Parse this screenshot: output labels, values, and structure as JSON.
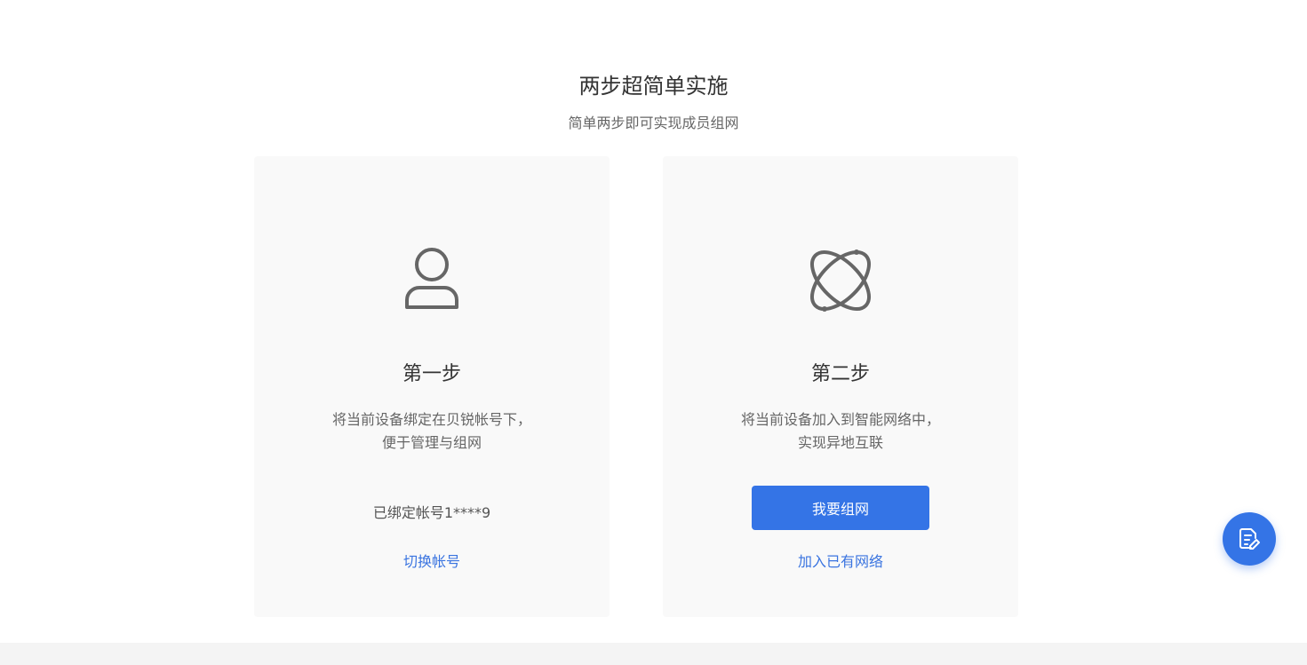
{
  "header": {
    "title": "两步超简单实施",
    "subtitle": "简单两步即可实现成员组网"
  },
  "step1": {
    "icon": "user-icon",
    "title": "第一步",
    "desc_line1": "将当前设备绑定在贝锐帐号下，",
    "desc_line2": "便于管理与组网",
    "bound_account": "已绑定帐号1****9",
    "switch_link": "切换帐号"
  },
  "step2": {
    "icon": "atom-network-icon",
    "title": "第二步",
    "desc_line1": "将当前设备加入到智能网络中，",
    "desc_line2": "实现异地互联",
    "primary_button": "我要组网",
    "join_link": "加入已有网络"
  },
  "fab": {
    "icon": "edit-document-icon"
  },
  "colors": {
    "accent": "#3474e6",
    "link": "#3a74e0",
    "card_bg": "#f9f9f9",
    "footer_bg": "#f4f4f4"
  }
}
